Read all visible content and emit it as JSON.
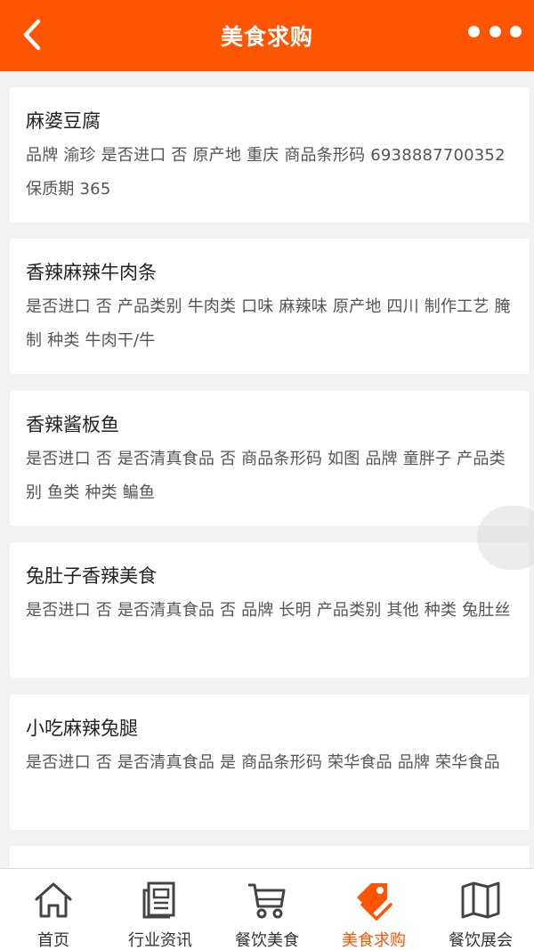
{
  "header": {
    "title": "美食求购"
  },
  "items": [
    {
      "name": "麻婆豆腐",
      "desc": "品牌 渝珍 是否进口 否 原产地 重庆 商品条形码 6938887700352 保质期 365"
    },
    {
      "name": "香辣麻辣牛肉条",
      "desc": "是否进口 否 产品类别 牛肉类 口味 麻辣味 原产地 四川 制作工艺 腌制 种类 牛肉干/牛"
    },
    {
      "name": "香辣酱板鱼",
      "desc": "是否进口 否 是否清真食品 否 商品条形码 如图 品牌 童胖子 产品类别 鱼类 种类 鳊鱼"
    },
    {
      "name": "兔肚子香辣美食",
      "desc": "是否进口 否 是否清真食品 否 品牌 长明 产品类别 其他 种类 兔肚丝"
    },
    {
      "name": "小吃麻辣兔腿",
      "desc": "是否进口 否 是否清真食品 是 商品条形码 荣华食品 品牌 荣华食品"
    }
  ],
  "tabs": [
    {
      "label": "首页",
      "icon": "home-icon"
    },
    {
      "label": "行业资讯",
      "icon": "news-icon"
    },
    {
      "label": "餐饮美食",
      "icon": "cart-icon"
    },
    {
      "label": "美食求购",
      "icon": "tag-icon"
    },
    {
      "label": "餐饮展会",
      "icon": "map-icon"
    }
  ],
  "colors": {
    "accent": "#ff5500",
    "background": "#f2f2f2"
  }
}
